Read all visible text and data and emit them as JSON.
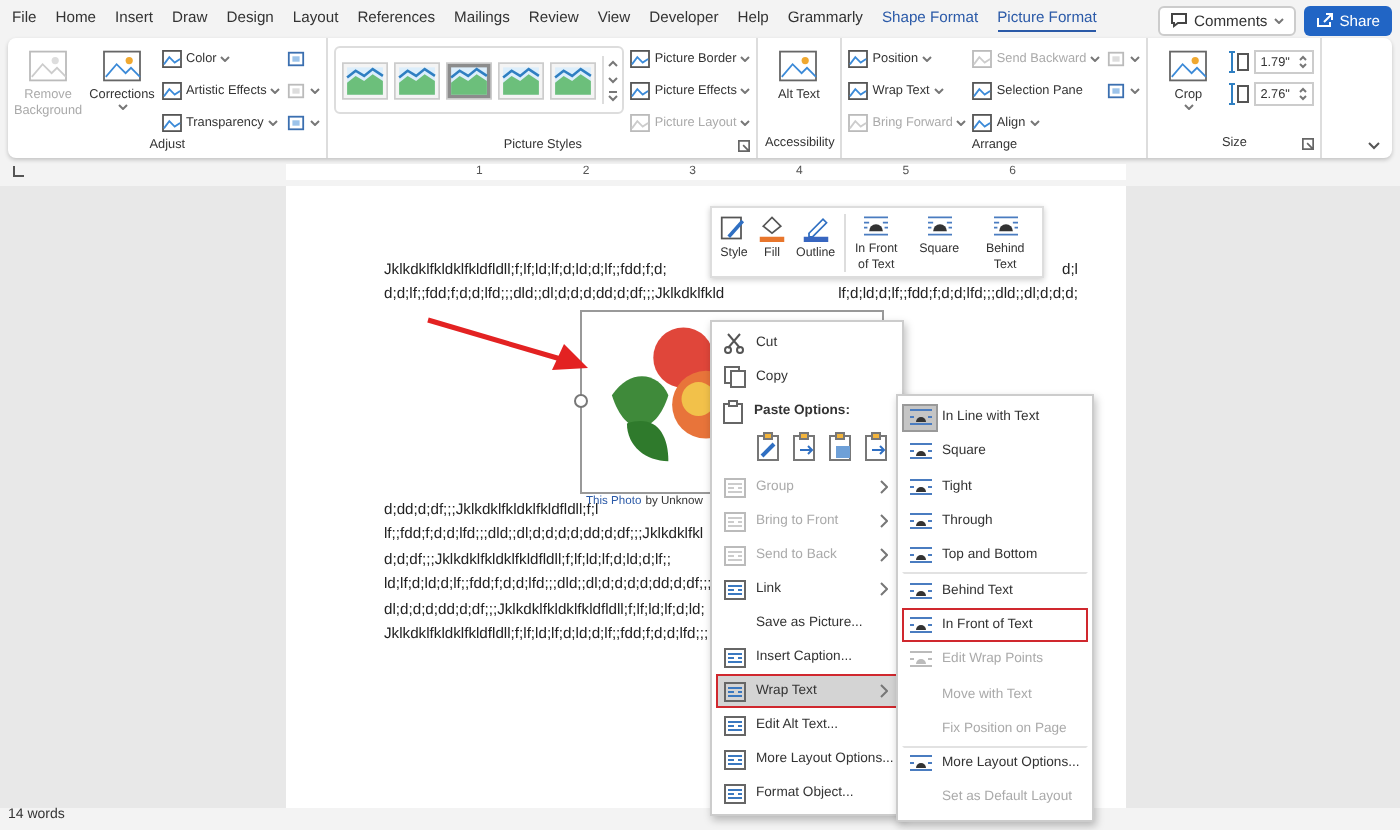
{
  "tabs": [
    {
      "label": "File",
      "selected": false,
      "contextual": false
    },
    {
      "label": "Home",
      "selected": false,
      "contextual": false
    },
    {
      "label": "Insert",
      "selected": false,
      "contextual": false
    },
    {
      "label": "Draw",
      "selected": false,
      "contextual": false
    },
    {
      "label": "Design",
      "selected": false,
      "contextual": false
    },
    {
      "label": "Layout",
      "selected": false,
      "contextual": false
    },
    {
      "label": "References",
      "selected": false,
      "contextual": false
    },
    {
      "label": "Mailings",
      "selected": false,
      "contextual": false
    },
    {
      "label": "Review",
      "selected": false,
      "contextual": false
    },
    {
      "label": "View",
      "selected": false,
      "contextual": false
    },
    {
      "label": "Developer",
      "selected": false,
      "contextual": false
    },
    {
      "label": "Help",
      "selected": false,
      "contextual": false
    },
    {
      "label": "Grammarly",
      "selected": false,
      "contextual": false
    },
    {
      "label": "Shape Format",
      "selected": false,
      "contextual": true
    },
    {
      "label": "Picture Format",
      "selected": true,
      "contextual": true
    }
  ],
  "comments_button": "Comments",
  "share_button": "Share",
  "ribbon": [
    {
      "label": "Adjust",
      "launcher": false,
      "columns": [
        [
          {
            "kind": "large",
            "label": "Remove Background",
            "disabled": true,
            "dropdown": false
          }
        ],
        [
          {
            "kind": "large",
            "label": "Corrections",
            "disabled": false,
            "dropdown": true
          }
        ],
        [
          {
            "kind": "small",
            "label": "Color",
            "disabled": false,
            "dropdown": true
          },
          {
            "kind": "small",
            "label": "Artistic Effects",
            "disabled": false,
            "dropdown": true
          },
          {
            "kind": "small",
            "label": "Transparency",
            "disabled": false,
            "dropdown": true
          }
        ],
        [
          {
            "kind": "icon",
            "disabled": false,
            "dropdown": false
          },
          {
            "kind": "icon",
            "disabled": true,
            "dropdown": true
          },
          {
            "kind": "icon",
            "disabled": false,
            "dropdown": true
          }
        ]
      ]
    },
    {
      "label": "Picture Styles",
      "launcher": true,
      "columns": [
        [
          {
            "kind": "gallery"
          }
        ],
        [
          {
            "kind": "small",
            "label": "Picture Border",
            "disabled": false,
            "dropdown": true
          },
          {
            "kind": "small",
            "label": "Picture Effects",
            "disabled": false,
            "dropdown": true
          },
          {
            "kind": "small",
            "label": "Picture Layout",
            "disabled": true,
            "dropdown": true
          }
        ]
      ]
    },
    {
      "label": "Accessibility",
      "launcher": false,
      "columns": [
        [
          {
            "kind": "large",
            "label": "Alt Text",
            "disabled": false,
            "dropdown": false
          }
        ]
      ]
    },
    {
      "label": "Arrange",
      "launcher": false,
      "columns": [
        [
          {
            "kind": "small",
            "label": "Position",
            "disabled": false,
            "dropdown": true
          },
          {
            "kind": "small",
            "label": "Wrap Text",
            "disabled": false,
            "dropdown": true
          },
          {
            "kind": "small",
            "label": "Bring Forward",
            "disabled": true,
            "dropdown": true
          }
        ],
        [
          {
            "kind": "small",
            "label": "Send Backward",
            "disabled": true,
            "dropdown": true
          },
          {
            "kind": "small",
            "label": "Selection Pane",
            "disabled": false,
            "dropdown": false
          },
          {
            "kind": "small",
            "label": "Align",
            "disabled": false,
            "dropdown": true
          }
        ],
        [
          {
            "kind": "icon",
            "disabled": true,
            "dropdown": true
          },
          {
            "kind": "icon",
            "disabled": false,
            "dropdown": true
          }
        ]
      ]
    },
    {
      "label": "Size",
      "launcher": true,
      "columns": [
        [
          {
            "kind": "large",
            "label": "Crop",
            "disabled": false,
            "dropdown": true
          }
        ],
        [
          {
            "kind": "spin",
            "value": "1.79\""
          },
          {
            "kind": "spin",
            "value": "2.76\""
          }
        ]
      ]
    }
  ],
  "ruler_labels": [
    "1",
    "2",
    "3",
    "4",
    "5",
    "6"
  ],
  "document": {
    "top_lines": [
      {
        "left": "Jklkdklfkldklfkldfldll;f;lf;ld;lf;d;ld;d;lf;;fdd;f;d;",
        "right": "d;l"
      },
      {
        "left": "d;d;lf;;fdd;f;d;d;lfd;;;dld;;dl;d;d;d;dd;d;df;;;Jklkdklfkld",
        "right": "lf;d;ld;d;lf;;fdd;f;d;d;lfd;;;dld;;dl;d;d;d;"
      }
    ],
    "bottom_lines": [
      "d;dd;d;df;;;Jklkdklfkldklfkldfldll;f;l",
      "lf;;fdd;f;d;d;lfd;;;dld;;dl;d;d;d;d;dd;d;df;;;Jklkdklfkl",
      "d;d;df;;;Jklkdklfkldklfkldfldll;f;lf;ld;lf;d;ld;d;lf;;",
      "ld;lf;d;ld;d;lf;;fdd;f;d;d;lfd;;;dld;;dl;d;d;d;d;dd;d;df;;;",
      "dl;d;d;d;dd;d;df;;;Jklkdklfkldklfkldfldll;f;lf;ld;lf;d;ld;",
      "Jklkdklfkldklfkldfldll;f;lf;ld;lf;d;ld;d;lf;;fdd;f;d;d;lfd;;;"
    ],
    "caption_link": "This Photo",
    "caption_text": "by Unknow"
  },
  "mini_toolbar": [
    {
      "label": "Style",
      "kind": "style"
    },
    {
      "label": "Fill",
      "kind": "fill"
    },
    {
      "label": "Outline",
      "kind": "outline"
    },
    {
      "label": "In Front of Text",
      "kind": "wrap"
    },
    {
      "label": "Square",
      "kind": "wrap"
    },
    {
      "label": "Behind Text",
      "kind": "wrap"
    }
  ],
  "context_menu": [
    {
      "kind": "item",
      "label": "Cut",
      "disabled": false,
      "submenu": false,
      "selected": false,
      "outlined": false
    },
    {
      "kind": "item",
      "label": "Copy",
      "disabled": false,
      "submenu": false,
      "selected": false,
      "outlined": false
    },
    {
      "kind": "header",
      "label": "Paste Options:"
    },
    {
      "kind": "paste"
    },
    {
      "kind": "item",
      "label": "Group",
      "disabled": true,
      "submenu": true,
      "selected": false,
      "outlined": false
    },
    {
      "kind": "item",
      "label": "Bring to Front",
      "disabled": true,
      "submenu": true,
      "selected": false,
      "outlined": false
    },
    {
      "kind": "item",
      "label": "Send to Back",
      "disabled": true,
      "submenu": true,
      "selected": false,
      "outlined": false
    },
    {
      "kind": "item",
      "label": "Link",
      "disabled": false,
      "submenu": true,
      "selected": false,
      "outlined": false
    },
    {
      "kind": "plain",
      "label": "Save as Picture...",
      "disabled": false,
      "submenu": false,
      "selected": false,
      "outlined": false
    },
    {
      "kind": "item",
      "label": "Insert Caption...",
      "disabled": false,
      "submenu": false,
      "selected": false,
      "outlined": false
    },
    {
      "kind": "item",
      "label": "Wrap Text",
      "disabled": false,
      "submenu": true,
      "selected": true,
      "outlined": true
    },
    {
      "kind": "item",
      "label": "Edit Alt Text...",
      "disabled": false,
      "submenu": false,
      "selected": false,
      "outlined": false
    },
    {
      "kind": "item",
      "label": "More Layout Options...",
      "disabled": false,
      "submenu": false,
      "selected": false,
      "outlined": false
    },
    {
      "kind": "item",
      "label": "Format Object...",
      "disabled": false,
      "submenu": false,
      "selected": false,
      "outlined": false
    }
  ],
  "submenu": [
    {
      "kind": "item",
      "label": "In Line with Text",
      "disabled": false,
      "selected": true,
      "outlined": false
    },
    {
      "kind": "item",
      "label": "Square",
      "disabled": false,
      "selected": false,
      "outlined": false
    },
    {
      "kind": "item",
      "label": "Tight",
      "disabled": false,
      "selected": false,
      "outlined": false
    },
    {
      "kind": "item",
      "label": "Through",
      "disabled": false,
      "selected": false,
      "outlined": false
    },
    {
      "kind": "item",
      "label": "Top and Bottom",
      "disabled": false,
      "selected": false,
      "outlined": false
    },
    {
      "kind": "item",
      "label": "Behind Text",
      "disabled": false,
      "selected": false,
      "outlined": false
    },
    {
      "kind": "item",
      "label": "In Front of Text",
      "disabled": false,
      "selected": false,
      "outlined": true
    },
    {
      "kind": "item",
      "label": "Edit Wrap Points",
      "disabled": true,
      "selected": false,
      "outlined": false
    },
    {
      "kind": "plain",
      "label": "Move with Text",
      "disabled": true,
      "selected": false,
      "outlined": false
    },
    {
      "kind": "plain",
      "label": "Fix Position on Page",
      "disabled": true,
      "selected": false,
      "outlined": false
    },
    {
      "kind": "item",
      "label": "More Layout Options...",
      "disabled": false,
      "selected": false,
      "outlined": false
    },
    {
      "kind": "plain",
      "label": "Set as Default Layout",
      "disabled": true,
      "selected": false,
      "outlined": false
    }
  ],
  "status_bar": {
    "word_count": "14 words"
  }
}
